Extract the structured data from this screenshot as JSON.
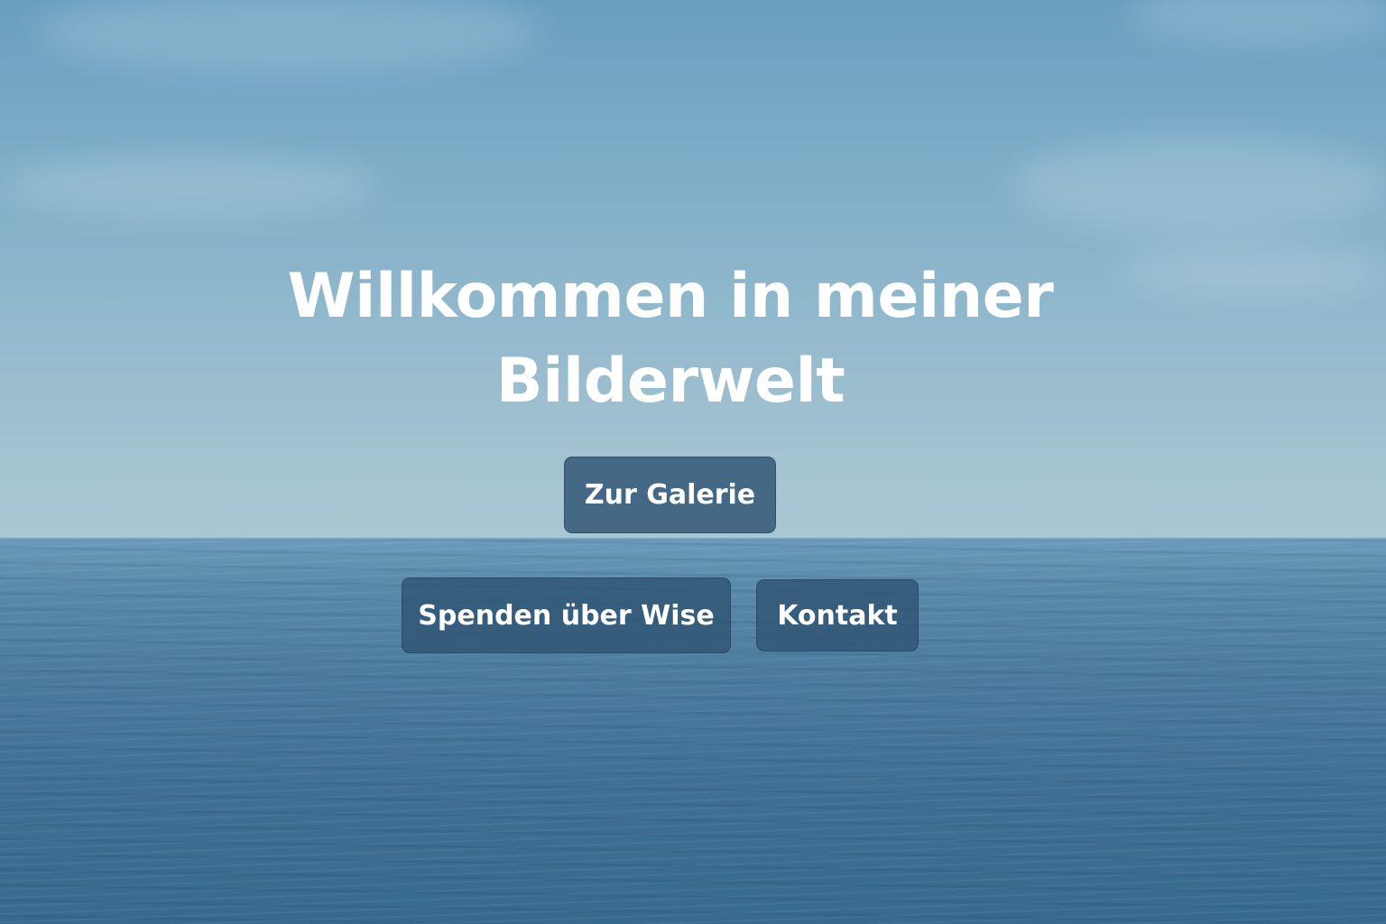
{
  "hero": {
    "title_line1": "Willkommen in meiner",
    "title_line2": "Bilderwelt"
  },
  "buttons": {
    "gallery_label": "Zur Galerie",
    "donate_label": "Spenden über Wise",
    "contact_label": "Kontakt"
  },
  "colors": {
    "button_background": "#305473",
    "title_text": "#ffffff",
    "sky": "#7aaac6",
    "sea": "#3f6f93"
  }
}
